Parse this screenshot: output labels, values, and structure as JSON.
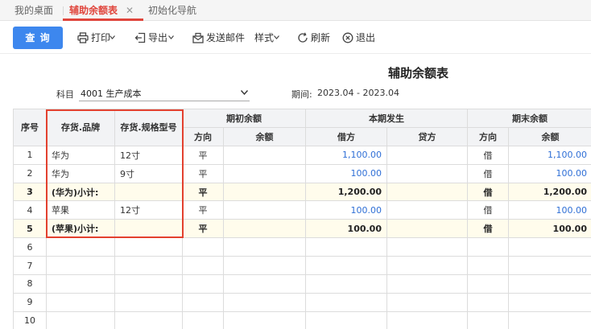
{
  "tabs": [
    {
      "label": "我的桌面"
    },
    {
      "label": "辅助余额表",
      "close": "✕"
    },
    {
      "label": "初始化导航"
    }
  ],
  "toolbar": {
    "query": "查 询",
    "print": "打印",
    "export": "导出",
    "send_mail": "发送邮件",
    "style": "样式",
    "refresh": "刷新",
    "exit": "退出"
  },
  "report": {
    "title": "辅助余额表",
    "subject_label": "科目",
    "subject_value": "4001 生产成本",
    "period_label": "期间:",
    "period_value": "2023.04 - 2023.04"
  },
  "table": {
    "headers": {
      "seq": "序号",
      "brand": "存货.品牌",
      "spec": "存货.规格型号",
      "opening": "期初余额",
      "current": "本期发生",
      "closing": "期末余额",
      "direction": "方向",
      "balance": "余额",
      "debit": "借方",
      "credit": "贷方"
    },
    "rows": [
      {
        "seq": "1",
        "brand": "华为",
        "spec": "12寸",
        "open_dir": "平",
        "open_bal": "",
        "debit": "1,100.00",
        "credit": "",
        "close_dir": "借",
        "close_bal": "1,100.00",
        "subtotal": false
      },
      {
        "seq": "2",
        "brand": "华为",
        "spec": "9寸",
        "open_dir": "平",
        "open_bal": "",
        "debit": "100.00",
        "credit": "",
        "close_dir": "借",
        "close_bal": "100.00",
        "subtotal": false
      },
      {
        "seq": "3",
        "brand": "(华为)小计:",
        "spec": "",
        "open_dir": "平",
        "open_bal": "",
        "debit": "1,200.00",
        "credit": "",
        "close_dir": "借",
        "close_bal": "1,200.00",
        "subtotal": true
      },
      {
        "seq": "4",
        "brand": "苹果",
        "spec": "12寸",
        "open_dir": "平",
        "open_bal": "",
        "debit": "100.00",
        "credit": "",
        "close_dir": "借",
        "close_bal": "100.00",
        "subtotal": false
      },
      {
        "seq": "5",
        "brand": "(苹果)小计:",
        "spec": "",
        "open_dir": "平",
        "open_bal": "",
        "debit": "100.00",
        "credit": "",
        "close_dir": "借",
        "close_bal": "100.00",
        "subtotal": true
      },
      {
        "seq": "6",
        "brand": "",
        "spec": "",
        "open_dir": "",
        "open_bal": "",
        "debit": "",
        "credit": "",
        "close_dir": "",
        "close_bal": "",
        "subtotal": false
      },
      {
        "seq": "7",
        "brand": "",
        "spec": "",
        "open_dir": "",
        "open_bal": "",
        "debit": "",
        "credit": "",
        "close_dir": "",
        "close_bal": "",
        "subtotal": false
      },
      {
        "seq": "8",
        "brand": "",
        "spec": "",
        "open_dir": "",
        "open_bal": "",
        "debit": "",
        "credit": "",
        "close_dir": "",
        "close_bal": "",
        "subtotal": false
      },
      {
        "seq": "9",
        "brand": "",
        "spec": "",
        "open_dir": "",
        "open_bal": "",
        "debit": "",
        "credit": "",
        "close_dir": "",
        "close_bal": "",
        "subtotal": false
      },
      {
        "seq": "10",
        "brand": "",
        "spec": "",
        "open_dir": "",
        "open_bal": "",
        "debit": "",
        "credit": "",
        "close_dir": "",
        "close_bal": "",
        "subtotal": false
      }
    ]
  },
  "icons": {
    "print": "printer-icon",
    "export": "export-icon",
    "send_mail": "mail-icon",
    "refresh": "refresh-icon",
    "exit": "exit-icon"
  },
  "colors": {
    "primary": "#3d87ee",
    "active_tab": "#e0453c",
    "value_blue": "#2f6fd6",
    "subtotal_bg": "#fffcec",
    "highlight": "#e3412f"
  }
}
